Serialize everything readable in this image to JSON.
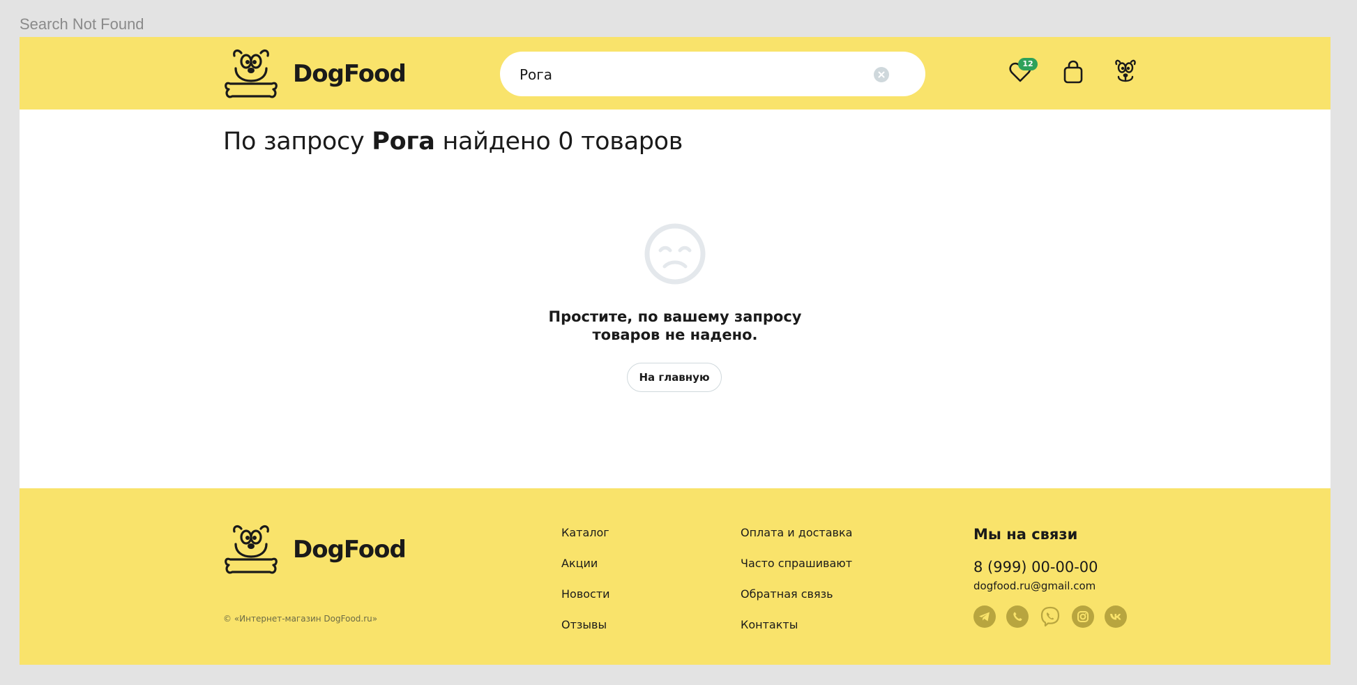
{
  "frame_label": "Search Not Found",
  "header": {
    "logo_text": "DogFood",
    "search": {
      "value": "Рога",
      "placeholder": ""
    },
    "favorites_count": "12"
  },
  "main": {
    "title_prefix": "По запросу",
    "query": "Рога",
    "title_suffix": "найдено 0 товаров",
    "empty_line1": "Простите, по вашему запросу",
    "empty_line2": "товаров не надено.",
    "home_button": "На главную"
  },
  "footer": {
    "logo_text": "DogFood",
    "copyright": "© «Интернет-магазин DogFood.ru»",
    "col1": [
      "Каталог",
      "Акции",
      "Новости",
      "Отзывы"
    ],
    "col2": [
      "Оплата и доставка",
      "Часто спрашивают",
      "Обратная связь",
      "Контакты"
    ],
    "contacts_title": "Мы на связи",
    "phone": "8 (999) 00-00-00",
    "email": "dogfood.ru@gmail.com",
    "socials": [
      "telegram-icon",
      "whatsapp-icon",
      "viber-icon",
      "instagram-icon",
      "vk-icon"
    ]
  },
  "colors": {
    "brand_yellow": "#f9e36b",
    "badge_green": "#2ea15a",
    "social_olive": "#b8a53f",
    "empty_icon_gray": "#e4e8ec"
  }
}
